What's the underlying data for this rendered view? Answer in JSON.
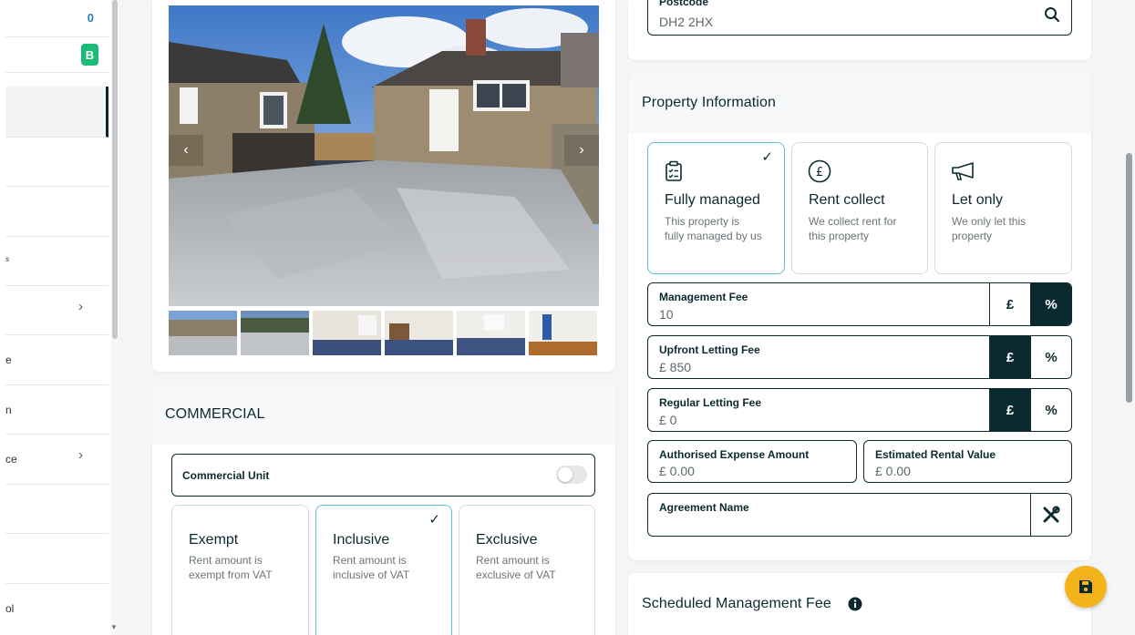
{
  "sidebar": {
    "count_value": "0",
    "badge_label": "B",
    "fragments": [
      "s",
      "e",
      "n",
      "ce",
      "ol"
    ]
  },
  "photos": {
    "prev_label": "‹",
    "next_label": "›",
    "thumbnail_count": 6
  },
  "commercial": {
    "title": "COMMERCIAL",
    "unit_label": "Commercial Unit",
    "unit_enabled": false,
    "vat_options": [
      {
        "title": "Exempt",
        "desc_line1": "Rent amount is",
        "desc_line2": "exempt from VAT",
        "selected": false
      },
      {
        "title": "Inclusive",
        "desc_line1": "Rent amount is",
        "desc_line2": "inclusive of VAT",
        "selected": true
      },
      {
        "title": "Exclusive",
        "desc_line1": "Rent amount is",
        "desc_line2": "exclusive of VAT",
        "selected": false
      }
    ]
  },
  "postcode": {
    "label": "Postcode",
    "value": "DH2 2HX",
    "icon": "search-icon"
  },
  "property_info": {
    "title": "Property Information",
    "service_options": [
      {
        "title": "Fully managed",
        "desc_line1": "This property is",
        "desc_line2": "fully managed by us",
        "icon": "clipboard-icon",
        "selected": true
      },
      {
        "title": "Rent collect",
        "desc_line1": "We collect rent for",
        "desc_line2": "this property",
        "icon": "pound-circle-icon",
        "selected": false
      },
      {
        "title": "Let only",
        "desc_line1": "We only let this",
        "desc_line2": "property",
        "icon": "megaphone-icon",
        "selected": false
      }
    ],
    "management_fee": {
      "label": "Management Fee",
      "value": "10",
      "pound": "£",
      "percent": "%",
      "active_unit": "percent"
    },
    "upfront_fee": {
      "label": "Upfront Letting Fee",
      "value": "£ 850",
      "pound": "£",
      "percent": "%",
      "active_unit": "pound"
    },
    "regular_fee": {
      "label": "Regular Letting Fee",
      "value": "£ 0",
      "pound": "£",
      "percent": "%",
      "active_unit": "pound"
    },
    "authorised_expense": {
      "label": "Authorised Expense Amount",
      "value": "£ 0.00"
    },
    "estimated_rental": {
      "label": "Estimated Rental Value",
      "value": "£ 0.00"
    },
    "agreement": {
      "label": "Agreement Name",
      "value": "",
      "icon": "tools-icon"
    }
  },
  "scheduled_fee": {
    "title": "Scheduled Management Fee",
    "icon": "info-icon"
  },
  "save_button": {
    "icon": "save-icon"
  },
  "colors": {
    "primary": "#0b2a2f",
    "accent": "#f5b31b",
    "success": "#1dbb78",
    "selected_border": "#5cc0d6"
  }
}
